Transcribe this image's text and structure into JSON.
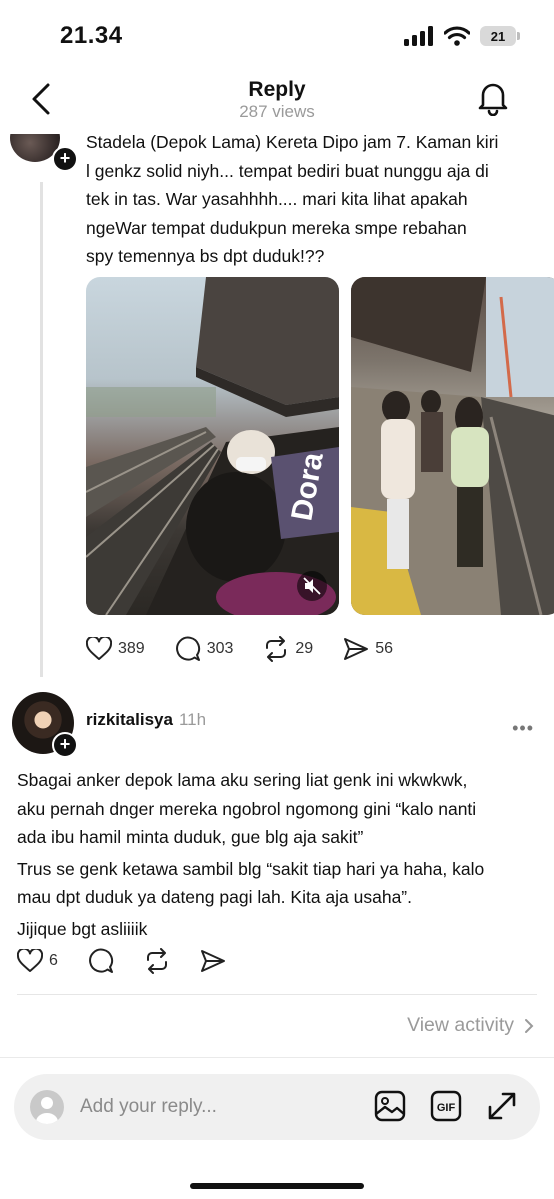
{
  "status_bar": {
    "time": "21.34",
    "battery": "21"
  },
  "nav": {
    "title": "Reply",
    "subtitle": "287 views"
  },
  "post": {
    "text_lines": [
      "Stadela (Depok Lama) Kereta Dipo jam 7. Kaman kiri",
      "l genkz solid niyh... tempat bediri buat nunggu aja di",
      "tek in tas. War yasahhhh.... mari kita lihat apakah",
      "ngeWar tempat dudukpun mereka smpe rebahan",
      "spy temennya bs dpt duduk!??"
    ],
    "photo_text": "Dora",
    "likes": "389",
    "comments": "303",
    "reposts": "29",
    "shares": "56"
  },
  "reply": {
    "username": "rizkitalisya",
    "time": "11h",
    "text_lines": [
      "Sbagai anker depok lama aku sering liat genk ini wkwkwk,",
      "aku pernah dnger mereka ngobrol ngomong gini “kalo nanti",
      "ada ibu hamil minta duduk, gue blg aja sakit”",
      "Trus se genk ketawa sambil blg “sakit tiap hari ya haha, kalo",
      "mau dpt duduk ya dateng pagi lah. Kita aja usaha”.",
      "Jijique bgt asliiiik"
    ],
    "likes": "6"
  },
  "view_activity": "View activity",
  "composer": {
    "placeholder": "Add your reply..."
  },
  "colors": {
    "muted": "#9a9a9a",
    "thread_line": "#e2e2e2",
    "composer_bg": "#f0f0f0"
  }
}
